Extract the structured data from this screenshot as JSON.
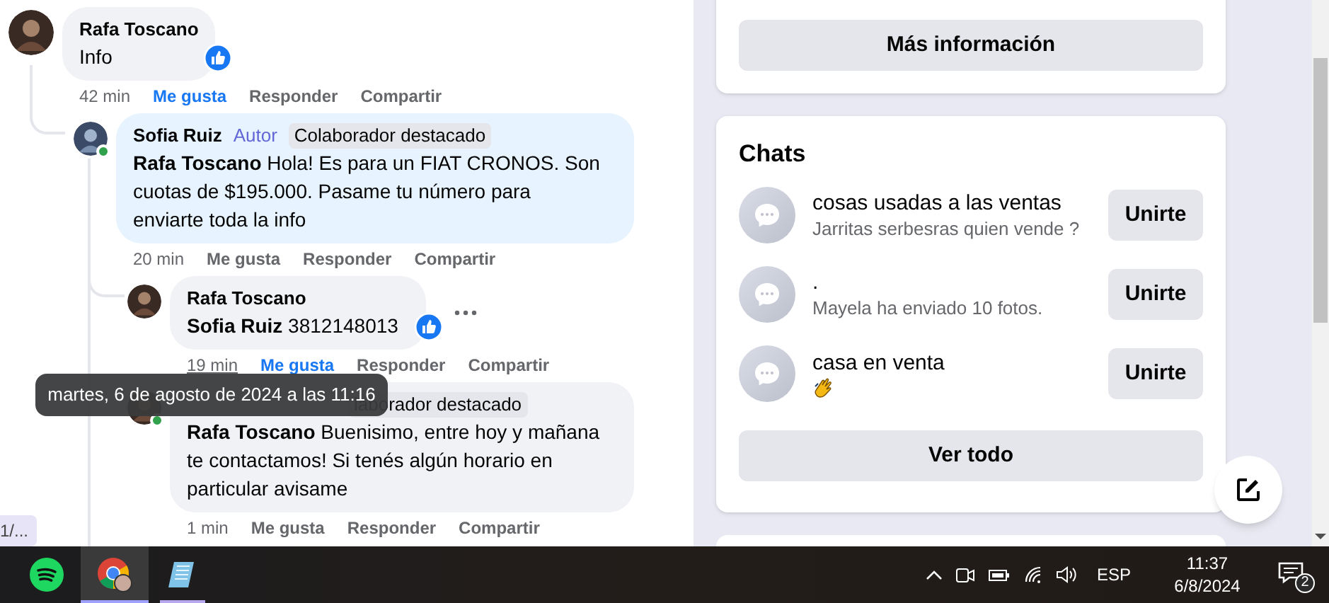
{
  "comments": [
    {
      "author": "Rafa Toscano",
      "text": "Info",
      "reaction": true,
      "online": false,
      "more_menu": false,
      "time": "42 min",
      "time_hovered": false,
      "actions": [
        {
          "label": "Me gusta",
          "selected": true
        },
        {
          "label": "Responder",
          "selected": false
        },
        {
          "label": "Compartir",
          "selected": false
        }
      ],
      "children": [
        {
          "author": "Sofia Ruiz",
          "badges": [
            {
              "text": "Autor",
              "kind": "author"
            },
            {
              "text": "Colaborador destacado",
              "kind": "top"
            }
          ],
          "text": "**Rafa Toscano** Hola! Es para un FIAT CRONOS. Son cuotas de $195.000. Pasame tu número para enviarte toda la info",
          "reaction": false,
          "online": true,
          "more_menu": false,
          "time": "20 min",
          "time_hovered": false,
          "actions": [
            {
              "label": "Me gusta",
              "selected": false
            },
            {
              "label": "Responder",
              "selected": false
            },
            {
              "label": "Compartir",
              "selected": false
            }
          ],
          "children": [
            {
              "author": "Rafa Toscano",
              "text": "**Sofia Ruiz** 3812148013",
              "reaction": true,
              "online": false,
              "more_menu": true,
              "time": "19 min",
              "time_hovered": true,
              "actions": [
                {
                  "label": "Me gusta",
                  "selected": true
                },
                {
                  "label": "Responder",
                  "selected": false
                },
                {
                  "label": "Compartir",
                  "selected": false
                }
              ]
            },
            {
              "badges": [
                {
                  "text": "laborador destacado",
                  "kind": "top"
                }
              ],
              "text": "**Rafa Toscano** Buenisimo, entre hoy y mañana te contactamos! Si tenés algún horario en particular avisame",
              "reaction": false,
              "online": true,
              "more_menu": false,
              "time": "1 min",
              "time_hovered": false,
              "actions": [
                {
                  "label": "Me gusta",
                  "selected": false
                },
                {
                  "label": "Responder",
                  "selected": false
                },
                {
                  "label": "Compartir",
                  "selected": false
                }
              ]
            }
          ]
        }
      ]
    }
  ],
  "tooltip": {
    "text": "martes, 6 de agosto de 2024 a las 11:16"
  },
  "side_chip": {
    "text": "1/..."
  },
  "info_card": {
    "button": "Más información"
  },
  "chats_card": {
    "title": "Chats",
    "button": "Ver todo",
    "chats": [
      {
        "title": "cosas usadas a las ventas",
        "kind": "text",
        "subtitle": "Jarritas serbesras quien vende ?",
        "button": "Unirte"
      },
      {
        "title": ".",
        "kind": "text",
        "subtitle": "Mayela ha enviado 10 fotos.",
        "button": "Unirte"
      },
      {
        "title": "casa en venta",
        "kind": "emoji",
        "button": "Unirte"
      }
    ]
  },
  "taskbar": {
    "apps": [
      {
        "kind": "spotify",
        "selected": false,
        "running": false
      },
      {
        "kind": "chrome",
        "selected": true,
        "running": false
      },
      {
        "kind": "notepad",
        "selected": false,
        "running": true
      }
    ],
    "language": "ESP",
    "time": "11:37",
    "date": "6/8/2024",
    "notifications": "2"
  }
}
